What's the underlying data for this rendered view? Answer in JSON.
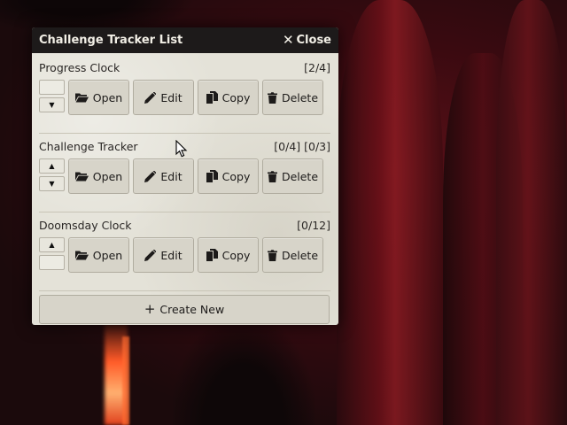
{
  "window": {
    "title": "Challenge Tracker List",
    "close_label": "Close"
  },
  "trackers": [
    {
      "name": "Progress Clock",
      "status": "[2/4]",
      "arrows": [
        "empty",
        "down"
      ],
      "buttons": {
        "open": "Open",
        "edit": "Edit",
        "copy": "Copy",
        "delete": "Delete"
      }
    },
    {
      "name": "Challenge Tracker",
      "status": "[0/4] [0/3]",
      "arrows": [
        "up",
        "down"
      ],
      "buttons": {
        "open": "Open",
        "edit": "Edit",
        "copy": "Copy",
        "delete": "Delete"
      }
    },
    {
      "name": "Doomsday Clock",
      "status": "[0/12]",
      "arrows": [
        "up",
        "empty"
      ],
      "buttons": {
        "open": "Open",
        "edit": "Edit",
        "copy": "Copy",
        "delete": "Delete"
      }
    }
  ],
  "create_label": "Create New",
  "icons": {
    "close": "close-icon",
    "open": "folder-open-icon",
    "edit": "pencil-icon",
    "copy": "copy-icon",
    "delete": "trash-icon",
    "create": "plus-icon",
    "up": "caret-up-icon",
    "down": "caret-down-icon"
  }
}
